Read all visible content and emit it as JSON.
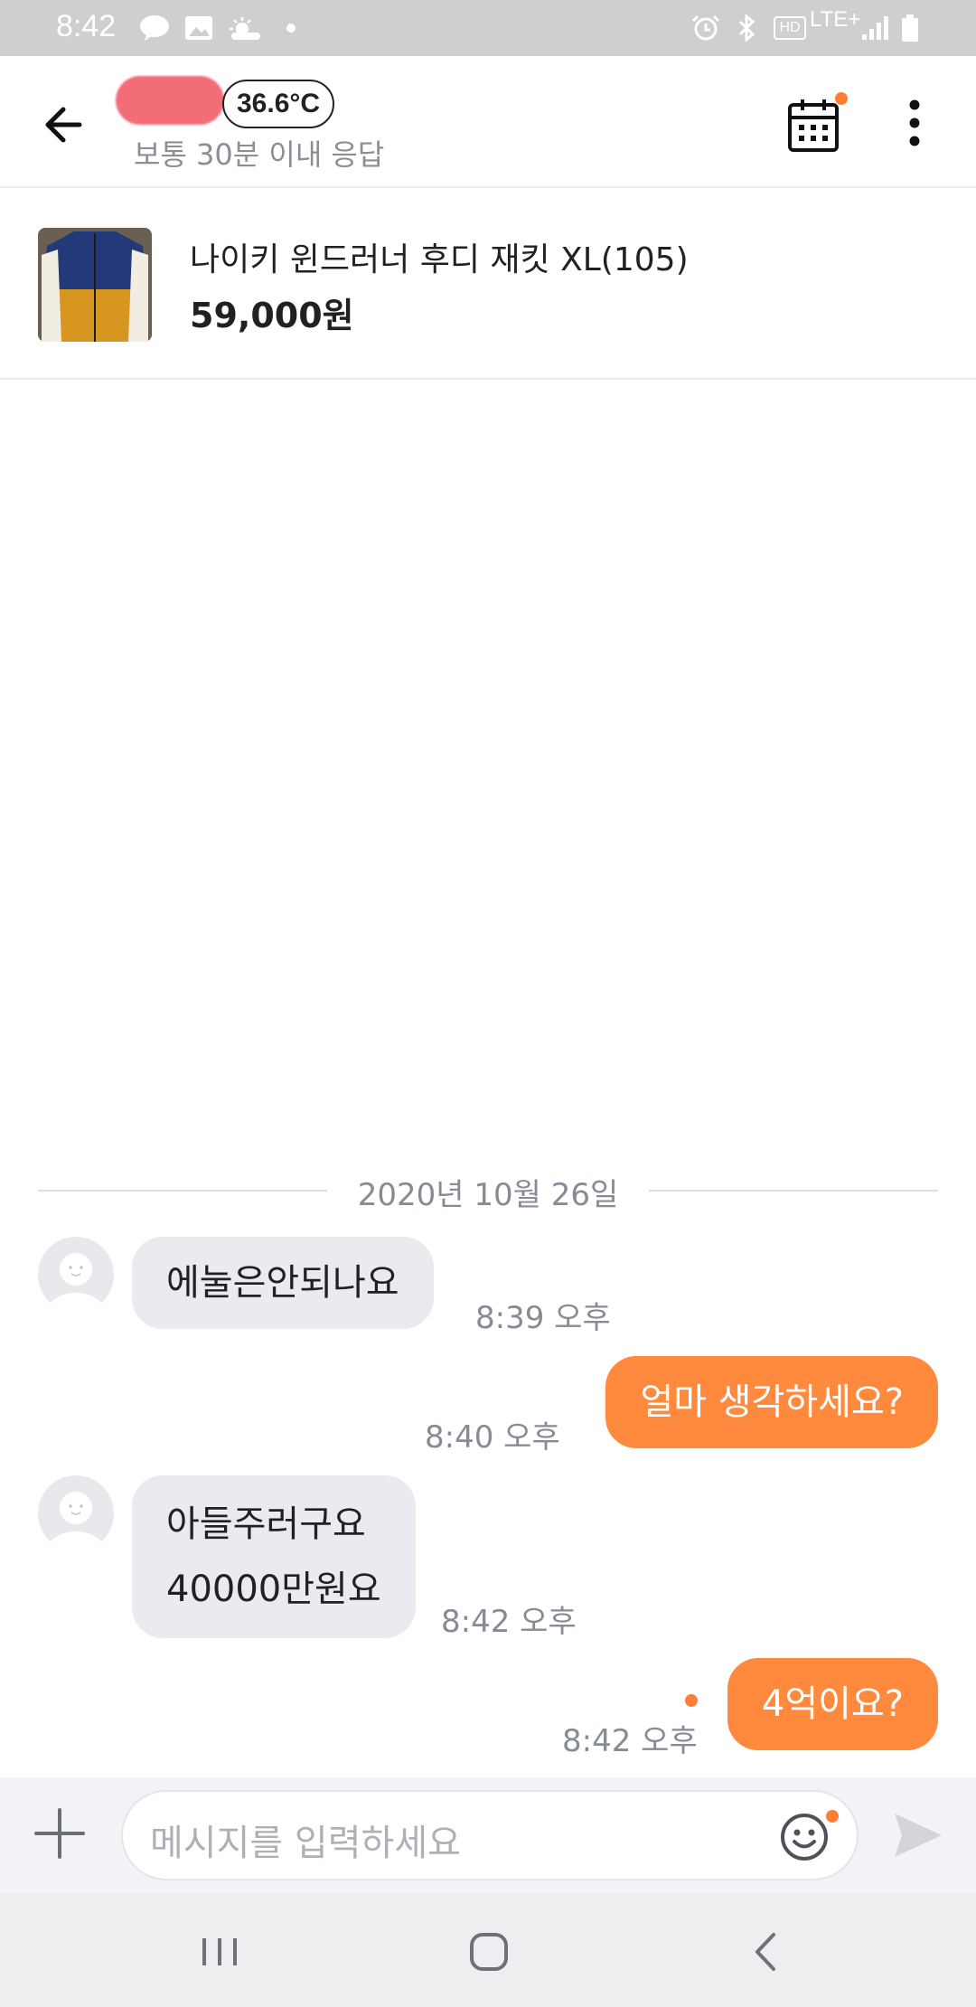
{
  "status_bar": {
    "time": "8:42",
    "left_icons": [
      "talk-icon",
      "gallery-icon",
      "weather-icon",
      "dot-icon"
    ],
    "right_icons": [
      "alarm-icon",
      "bluetooth-icon",
      "hd-icon",
      "lte-icon",
      "signal-icon",
      "battery-icon"
    ],
    "hd_label": "HD",
    "network_label": "LTE+"
  },
  "header": {
    "temperature": "36.6°C",
    "response_time": "보통 30분 이내 응답",
    "accent_color": "#ff7e36"
  },
  "product": {
    "title": "나이키 윈드러너 후디 재킷 XL(105)",
    "price": "59,000원"
  },
  "chat": {
    "date": "2020년 10월 26일",
    "messages": [
      {
        "sender": "other",
        "lines": [
          "에눌은안되나요"
        ],
        "time": "8:39 오후"
      },
      {
        "sender": "me",
        "lines": [
          "얼마 생각하세요?"
        ],
        "time": "8:40 오후"
      },
      {
        "sender": "other",
        "lines": [
          "아들주러구요",
          "40000만원요"
        ],
        "time": "8:42 오후"
      },
      {
        "sender": "me",
        "lines": [
          "4억이요?"
        ],
        "time": "8:42 오후",
        "unread": true
      }
    ]
  },
  "input": {
    "placeholder": "메시지를 입력하세요"
  },
  "colors": {
    "outgoing_bubble": "#ff8a3d",
    "incoming_bubble": "#eaebef"
  }
}
